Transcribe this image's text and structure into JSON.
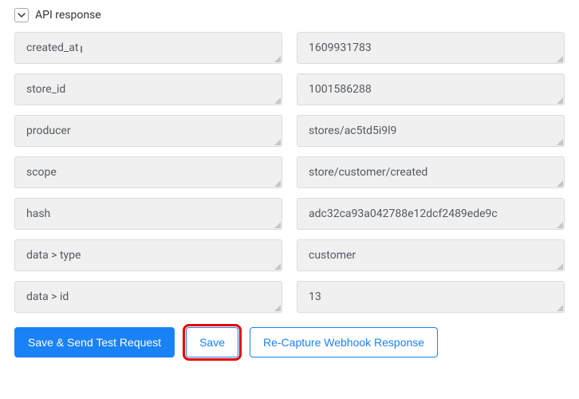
{
  "section": {
    "title": "API response"
  },
  "rows": [
    {
      "key": "created_at",
      "value": "1609931783",
      "cursor": true
    },
    {
      "key": "store_id",
      "value": "1001586288"
    },
    {
      "key": "producer",
      "value": "stores/ac5td5i9l9"
    },
    {
      "key": "scope",
      "value": "store/customer/created"
    },
    {
      "key": "hash",
      "value": "adc32ca93a042788e12dcf2489ede9c"
    },
    {
      "key": "data > type",
      "value": "customer"
    },
    {
      "key": "data > id",
      "value": "13"
    }
  ],
  "buttons": {
    "save_send": "Save & Send Test Request",
    "save": "Save",
    "recapture": "Re-Capture Webhook Response"
  }
}
